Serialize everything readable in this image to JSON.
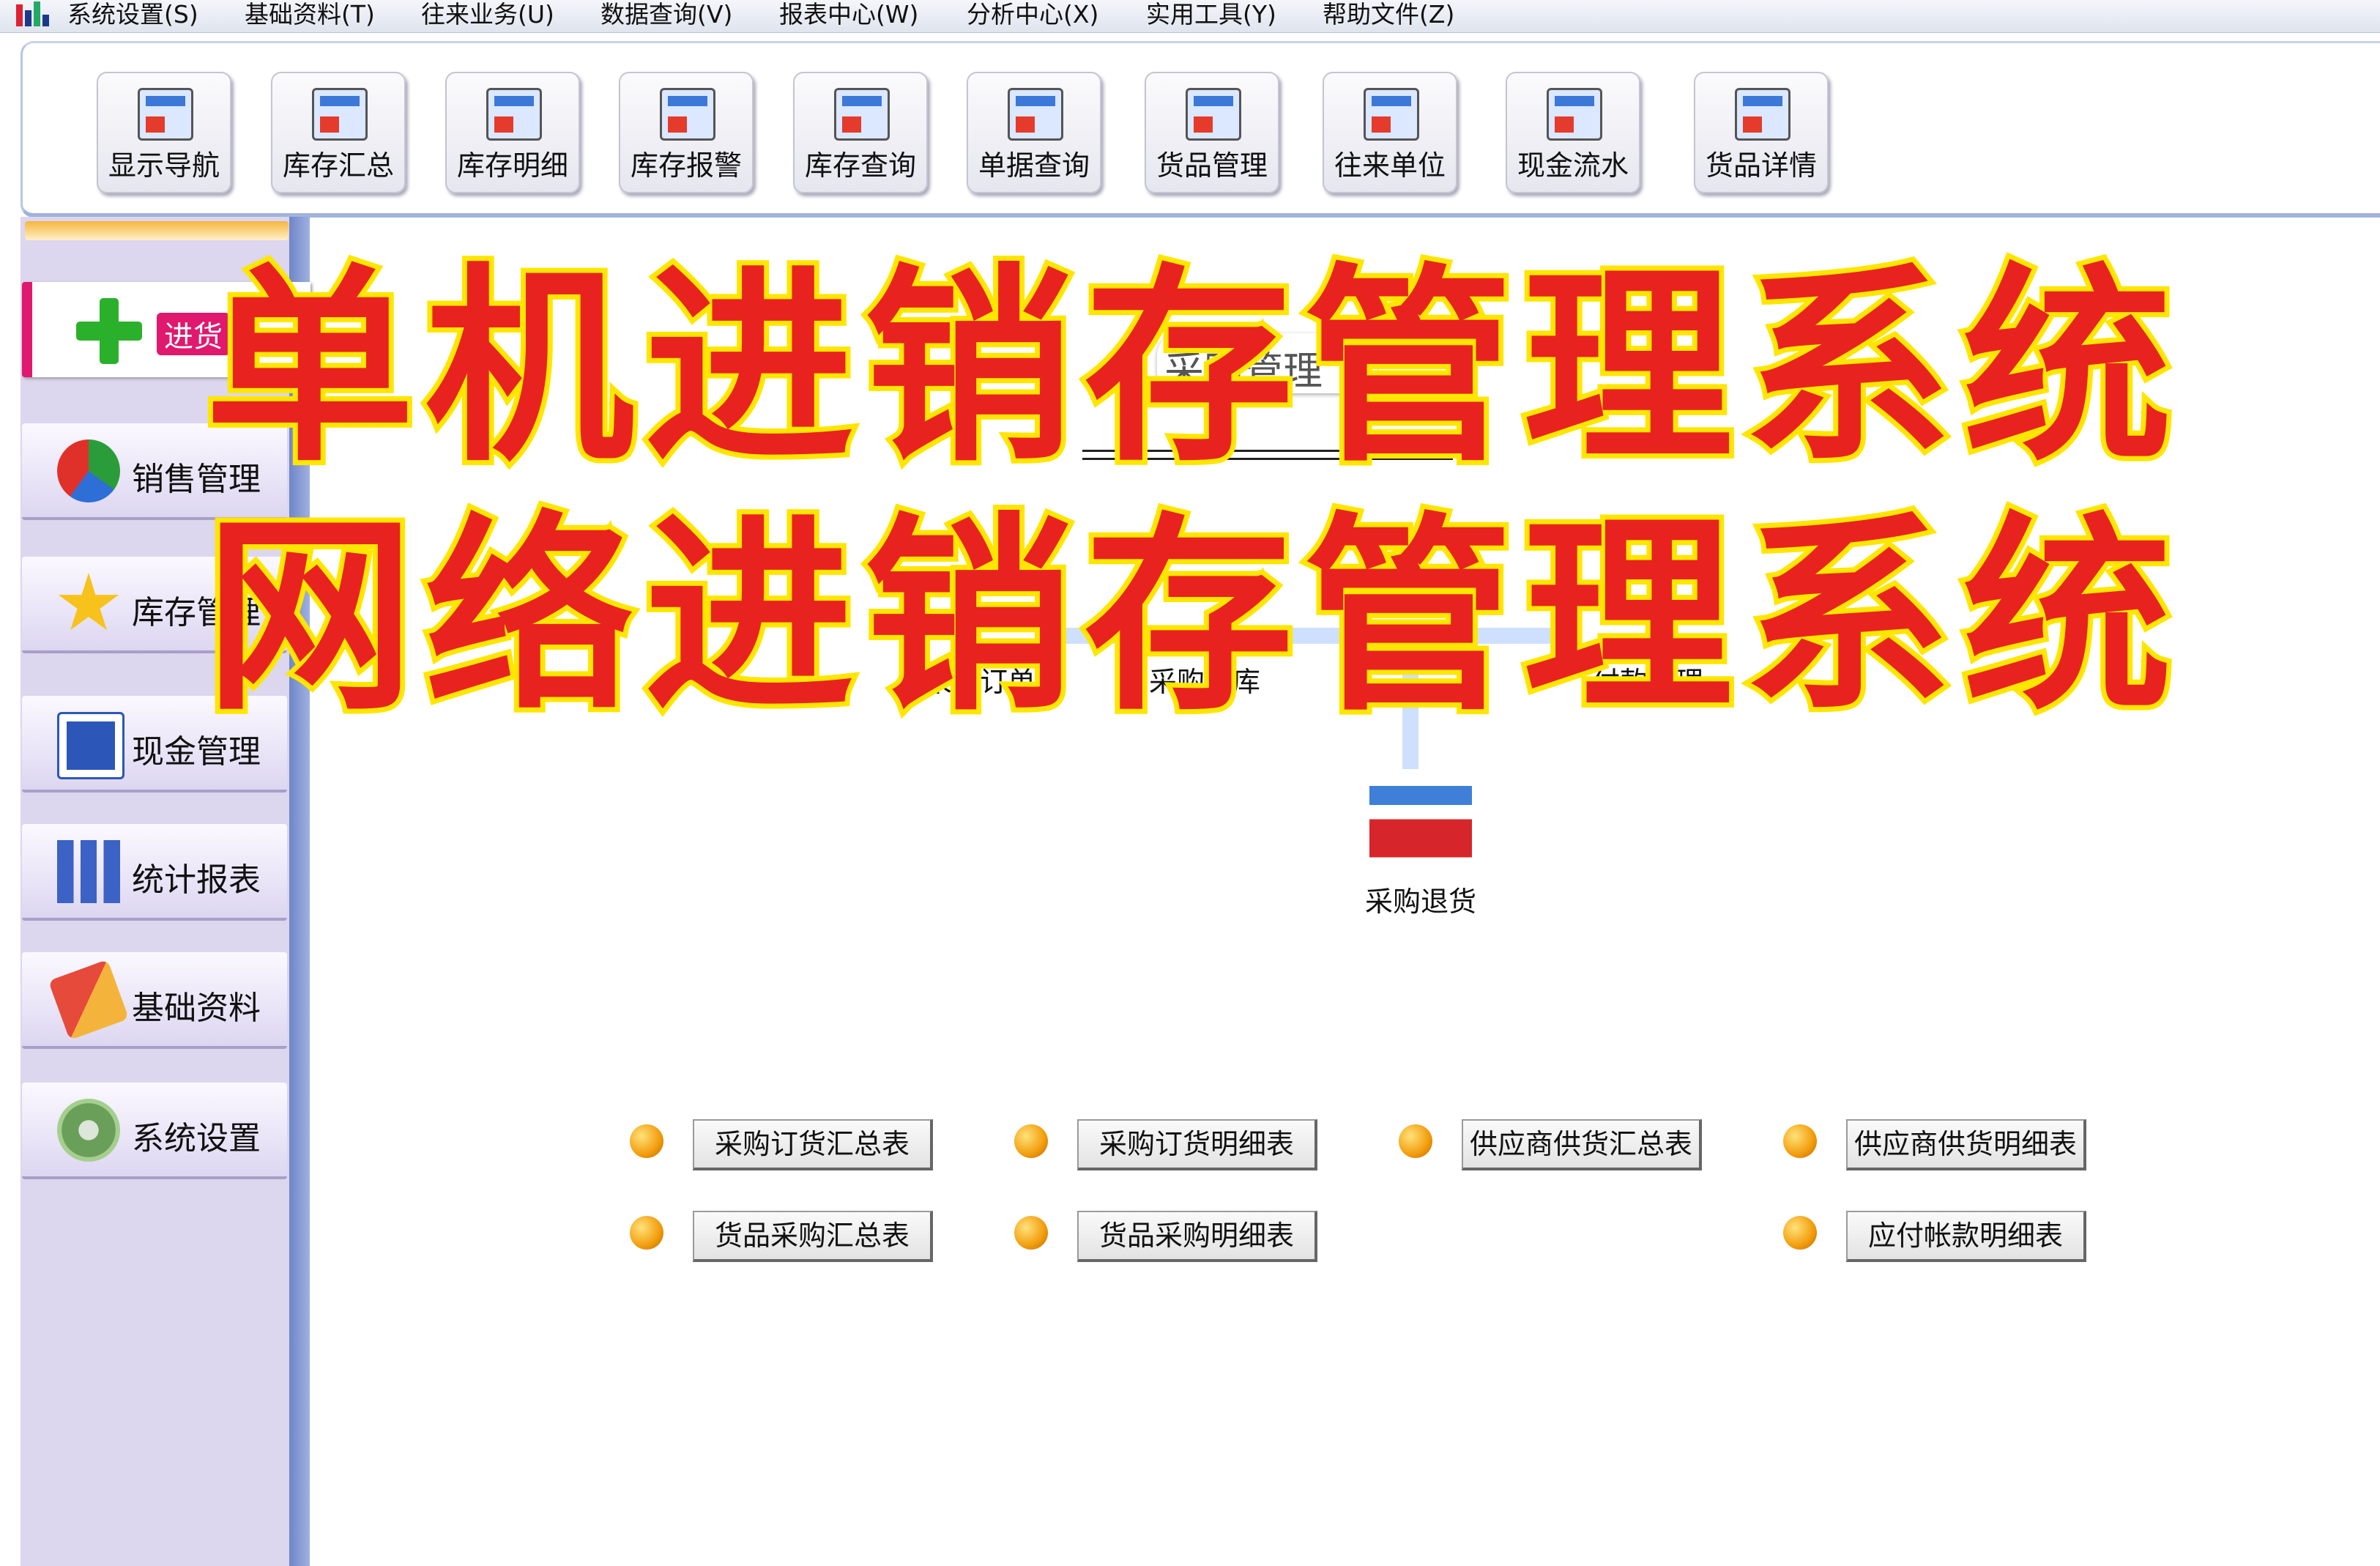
{
  "menubar": {
    "logo_icon": "bar-chart-icon",
    "items": [
      "系统设置(S)",
      "基础资料(T)",
      "往来业务(U)",
      "数据查询(V)",
      "报表中心(W)",
      "分析中心(X)",
      "实用工具(Y)",
      "帮助文件(Z)"
    ]
  },
  "toolbar": {
    "buttons": [
      "显示导航",
      "库存汇总",
      "库存明细",
      "库存报警",
      "库存查询",
      "单据查询",
      "货品管理",
      "往来单位",
      "现金流水",
      "货品详情"
    ]
  },
  "sidebar": {
    "current_label": "进货",
    "items": [
      "销售管理",
      "库存管理",
      "现金管理",
      "统计报表",
      "基础资料",
      "系统设置"
    ]
  },
  "main": {
    "section_title": "采购管理",
    "flow": {
      "purchase_order": "采购订单",
      "purchase_in": "采购入库",
      "payment": "付款管理",
      "purchase_return": "采购退货"
    },
    "reports": {
      "row1": [
        "采购订货汇总表",
        "采购订货明细表",
        "供应商供货汇总表",
        "供应商供货明细表"
      ],
      "row2": [
        "货品采购汇总表",
        "货品采购明细表",
        "应付帐款明细表"
      ]
    }
  },
  "overlay": {
    "line1": "单机进销存管理系统",
    "line2": "网络进销存管理系统"
  },
  "colors": {
    "accent_pink": "#e0186e",
    "promo_red": "#e8231f",
    "promo_yellow": "#ffe600",
    "panel_lavender": "#dcd6ee"
  }
}
